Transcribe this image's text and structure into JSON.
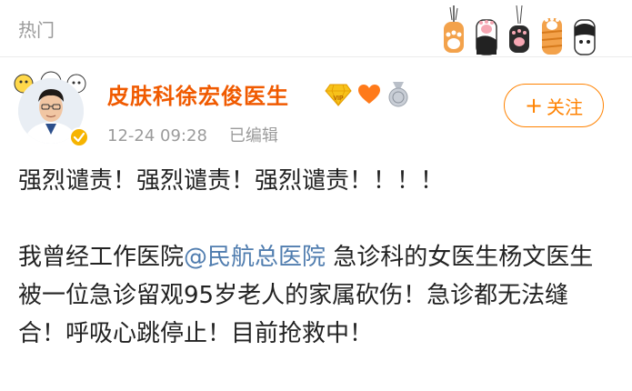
{
  "header": {
    "section_title": "热门",
    "paw_icons": [
      "paw-icon-orange",
      "paw-icon-black-white",
      "paw-icon-black",
      "paw-icon-orange-striped",
      "paw-icon-black-face"
    ]
  },
  "post": {
    "author": {
      "name": "皮肤科徐宏俊医生",
      "verified_badge_color": "#f6b400",
      "badges": [
        "vip-diamond-icon",
        "heart-icon",
        "medal-icon"
      ]
    },
    "time": "12-24 09:28",
    "edited": "已编辑",
    "follow": {
      "plus": "+",
      "label": "关注"
    },
    "text": {
      "line1": "强烈谴责！强烈谴责！强烈谴责！！！！",
      "para2_prefix": "我曾经工作医院",
      "mention": "@民航总医院",
      "para2_rest": " 急诊科的女医生杨文医生被一位急诊留观95岁老人的家属砍伤！急诊都无法缝合！呼吸心跳停止！目前抢救中！"
    }
  },
  "colors": {
    "username": "#f05a00",
    "follow_accent": "#ff8200",
    "mention": "#507daf",
    "meta_gray": "#9b9b9b"
  }
}
